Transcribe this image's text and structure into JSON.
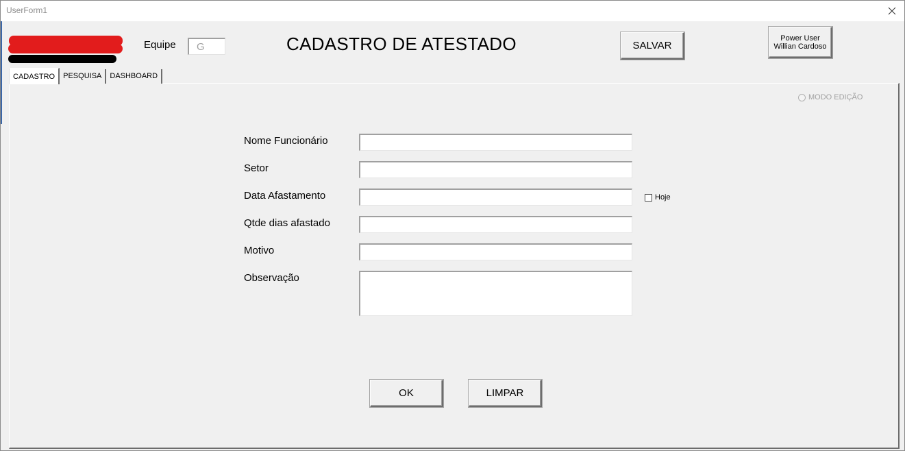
{
  "window": {
    "title": "UserForm1"
  },
  "header": {
    "equipe_label": "Equipe",
    "equipe_value": "G",
    "title": "CADASTRO DE ATESTADO",
    "save_label": "SALVAR",
    "user_line1": "Power User",
    "user_line2": "Willian Cardoso"
  },
  "tabs": [
    {
      "label": "CADASTRO",
      "active": true
    },
    {
      "label": "PESQUISA",
      "active": false
    },
    {
      "label": "DASHBOARD",
      "active": false
    }
  ],
  "form": {
    "edit_mode_label": "MODO EDIÇÃO",
    "fields": [
      {
        "label": "Nome Funcionário",
        "value": ""
      },
      {
        "label": "Setor",
        "value": ""
      },
      {
        "label": "Data Afastamento",
        "value": ""
      },
      {
        "label": "Qtde dias afastado",
        "value": ""
      },
      {
        "label": "Motivo",
        "value": ""
      },
      {
        "label": "Observação",
        "value": ""
      }
    ],
    "today_checkbox_label": "Hoje",
    "today_checked": false,
    "ok_label": "OK",
    "clear_label": "LIMPAR"
  },
  "colors": {
    "logo_red": "#e21c1c",
    "logo_black": "#000000",
    "window_bg": "#f0f0f0",
    "disabled_text": "#a0a0a0"
  },
  "icons": {
    "close": "close-icon",
    "logo": "logo-icon"
  }
}
